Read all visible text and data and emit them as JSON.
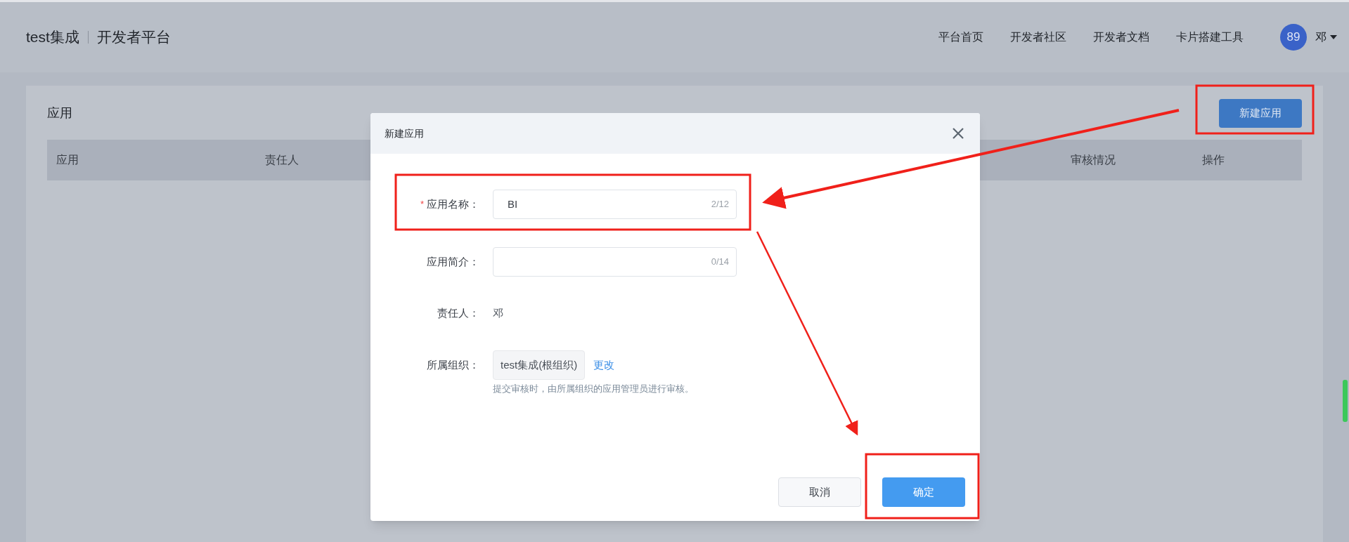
{
  "header": {
    "logo": "test集成",
    "product": "开发者平台",
    "nav": [
      "平台首页",
      "开发者社区",
      "开发者文档",
      "卡片搭建工具"
    ],
    "user": {
      "avatar": "89",
      "name": "邓"
    }
  },
  "page": {
    "title": "应用",
    "new_button": "新建应用",
    "table": {
      "columns": [
        "应用",
        "责任人",
        "审核情况",
        "操作"
      ]
    }
  },
  "dialog": {
    "title": "新建应用",
    "fields": [
      {
        "kind": "input",
        "label": "应用名称：",
        "required_mark": "*",
        "value": "BI",
        "count": "2/12"
      },
      {
        "kind": "input",
        "label": "应用简介：",
        "count": "0/14"
      },
      {
        "kind": "text",
        "label": "责任人：",
        "value": "邓"
      },
      {
        "kind": "org",
        "label": "所属组织：",
        "value": "test集成(根组织)",
        "link": "更改",
        "hint": "提交审核时，由所属组织的应用管理员进行审核。"
      }
    ],
    "buttons": [
      {
        "label": "取消",
        "primary": false
      },
      {
        "label": "确定",
        "primary": true
      }
    ]
  }
}
